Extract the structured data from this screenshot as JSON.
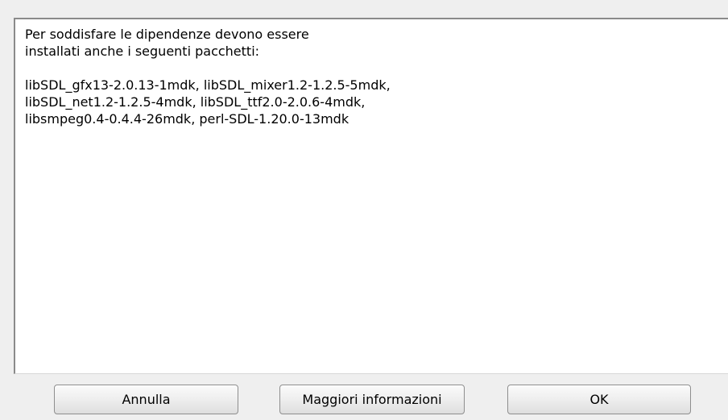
{
  "message": {
    "intro_lines": [
      "Per soddisfare le dipendenze devono essere",
      "installati anche i seguenti pacchetti:"
    ],
    "package_lines": [
      "libSDL_gfx13-2.0.13-1mdk, libSDL_mixer1.2-1.2.5-5mdk,",
      "libSDL_net1.2-1.2.5-4mdk, libSDL_ttf2.0-2.0.6-4mdk,",
      "libsmpeg0.4-0.4.4-26mdk, perl-SDL-1.20.0-13mdk"
    ]
  },
  "buttons": {
    "cancel_label": "Annulla",
    "info_label": "Maggiori informazioni",
    "ok_label": "OK"
  }
}
